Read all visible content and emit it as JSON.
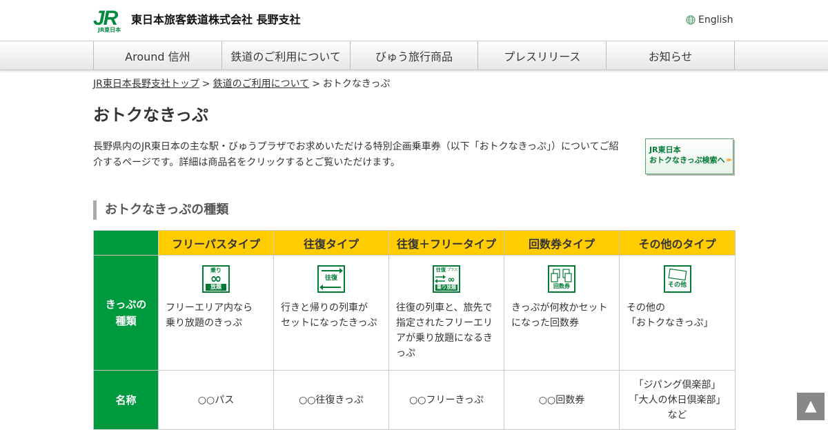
{
  "header": {
    "logo_mark": "JR",
    "logo_sub": "JR東日本",
    "corp_name": "東日本旅客鉄道株式会社 長野支社",
    "language_link": "English"
  },
  "nav": {
    "items": [
      {
        "label": "Around 信州"
      },
      {
        "label": "鉄道のご利用について"
      },
      {
        "label": "びゅう旅行商品"
      },
      {
        "label": "プレスリリース"
      },
      {
        "label": "お知らせ"
      }
    ]
  },
  "breadcrumb": {
    "items": [
      {
        "label": "JR東日本長野支社トップ"
      },
      {
        "label": "鉄道のご利用について"
      },
      {
        "label": "おトクなきっぷ"
      }
    ],
    "separator": ">"
  },
  "page": {
    "title": "おトクなきっぷ",
    "intro": "長野県内のJR東日本の主な駅・びゅうプラザでお求めいただける特別企画乗車券（以下「おトクなきっぷ」）についてご紹介するページです。詳細は商品名をクリックするとご覧いただけます。"
  },
  "search_banner": {
    "line1": "JR東日本",
    "line2": "おトクなきっぷ検索へ",
    "arrows": "»»"
  },
  "section": {
    "heading": "おトクなきっぷの種類"
  },
  "table": {
    "row_headers": {
      "type_line1": "きっぷの",
      "type_line2": "種類",
      "name": "名称"
    },
    "columns": [
      {
        "header": "フリーパスタイプ",
        "icon": "free-pass-icon",
        "icon_text_top": "乗り",
        "icon_symbol": "∞",
        "icon_text_bottom": "放題",
        "desc_line1": "フリーエリア内なら",
        "desc_line2": "乗り放題のきっぷ",
        "name": "○○パス"
      },
      {
        "header": "往復タイプ",
        "icon": "round-trip-icon",
        "icon_text": "往復",
        "desc_line1": "行きと帰りの列車が",
        "desc_line2": "セットになったきっぷ",
        "name": "○○往復きっぷ"
      },
      {
        "header": "往復＋フリータイプ",
        "icon": "round-trip-free-icon",
        "icon_text_top": "往復",
        "icon_text_plus": "プラス",
        "icon_text_bottom": "乗り放題",
        "desc_line1": "往復の列車と、旅先で",
        "desc_line2": "指定されたフリーエリ",
        "desc_line3": "アが乗り放題になるき",
        "desc_line4": "っぷ",
        "name": "○○フリーきっぷ"
      },
      {
        "header": "回数券タイプ",
        "icon": "coupon-ticket-icon",
        "icon_text": "回数券",
        "desc_line1": "きっぷが何枚かセット",
        "desc_line2": "になった回数券",
        "name": "○○回数券"
      },
      {
        "header": "その他のタイプ",
        "icon": "other-ticket-icon",
        "icon_text": "その他",
        "desc_line1": "その他の",
        "desc_line2": "「おトクなきっぷ」",
        "name_line1": "「ジパング倶楽部」",
        "name_line2": "「大人の休日倶楽部」",
        "name_line3": "など"
      }
    ]
  },
  "pagetop": {
    "label": "▲"
  },
  "colors": {
    "jr_green": "#009a3e",
    "header_yellow": "#ffcc00",
    "icon_green": "#007a33",
    "banner_arrow": "#f08a00",
    "pagetop_bg": "#888888"
  }
}
